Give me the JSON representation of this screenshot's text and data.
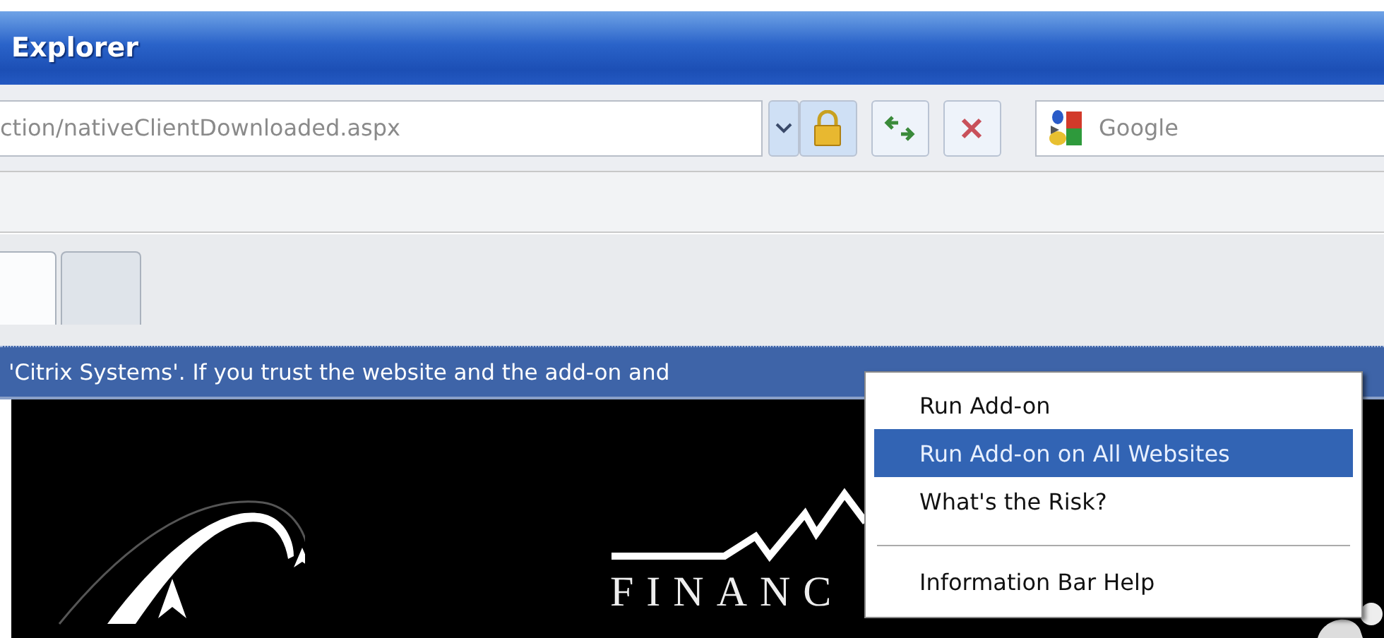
{
  "window": {
    "title": "Explorer"
  },
  "address_bar": {
    "value": "ction/nativeClientDownloaded.aspx"
  },
  "search": {
    "placeholder": "Google"
  },
  "tabs": [
    {
      "selected": true
    },
    {
      "selected": false
    }
  ],
  "info_bar": {
    "text": "'Citrix Systems'. If you trust the website and the add-on and"
  },
  "page": {
    "logo_text": "FINANC"
  },
  "context_menu": {
    "items": [
      {
        "kind": "item",
        "label": "Run Add-on",
        "selected": false
      },
      {
        "kind": "item",
        "label": "Run Add-on on All Websites",
        "selected": true
      },
      {
        "kind": "item",
        "label": "What's the Risk?",
        "selected": false
      },
      {
        "kind": "separator"
      },
      {
        "kind": "item",
        "label": "Information Bar Help",
        "selected": false
      }
    ]
  }
}
